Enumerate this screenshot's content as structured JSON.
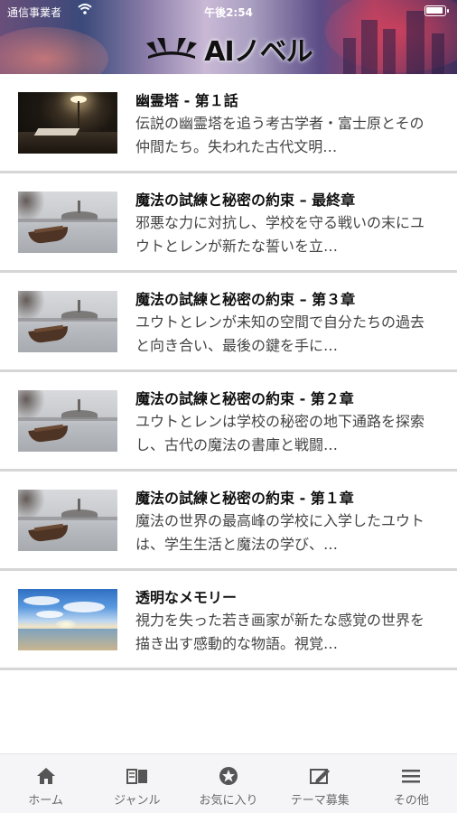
{
  "status_bar": {
    "carrier": "通信事業者",
    "time": "午後2:54",
    "battery_level": 0.95
  },
  "header": {
    "logo_text": "AIノベル"
  },
  "items": [
    {
      "title": "幽霊塔 - 第１話",
      "description": "伝説の幽霊塔を追う考古学者・富士原とその仲間たち。失われた古代文明…",
      "thumbnail": "lamp-on-desk-image"
    },
    {
      "title": "魔法の試練と秘密の約束 – 最終章",
      "description": "邪悪な力に対抗し、学校を守る戦いの末にユウトとレンが新たな誓いを立…",
      "thumbnail": "lake-boat-image"
    },
    {
      "title": "魔法の試練と秘密の約束 – 第３章",
      "description": "ユウトとレンが未知の空間で自分たちの過去と向き合い、最後の鍵を手に…",
      "thumbnail": "lake-boat-image"
    },
    {
      "title": "魔法の試練と秘密の約束 - 第２章",
      "description": "ユウトとレンは学校の秘密の地下通路を探索し、古代の魔法の書庫と戦闘…",
      "thumbnail": "lake-boat-image"
    },
    {
      "title": "魔法の試練と秘密の約束 - 第１章",
      "description": "魔法の世界の最高峰の学校に入学したユウトは、学生生活と魔法の学び、…",
      "thumbnail": "lake-boat-image"
    },
    {
      "title": "透明なメモリー",
      "description": "視力を失った若き画家が新たな感覚の世界を描き出す感動的な物語。視覚…",
      "thumbnail": "sky-sea-image"
    }
  ],
  "tabs": [
    {
      "label": "ホーム",
      "icon": "home-icon"
    },
    {
      "label": "ジャンル",
      "icon": "book-icon"
    },
    {
      "label": "お気に入り",
      "icon": "star-icon"
    },
    {
      "label": "テーマ募集",
      "icon": "edit-icon"
    },
    {
      "label": "その他",
      "icon": "menu-icon"
    }
  ],
  "colors": {
    "tab_icon": "#555555",
    "divider": "#d6d6d6",
    "tabbar_bg": "#f5f5f7"
  }
}
